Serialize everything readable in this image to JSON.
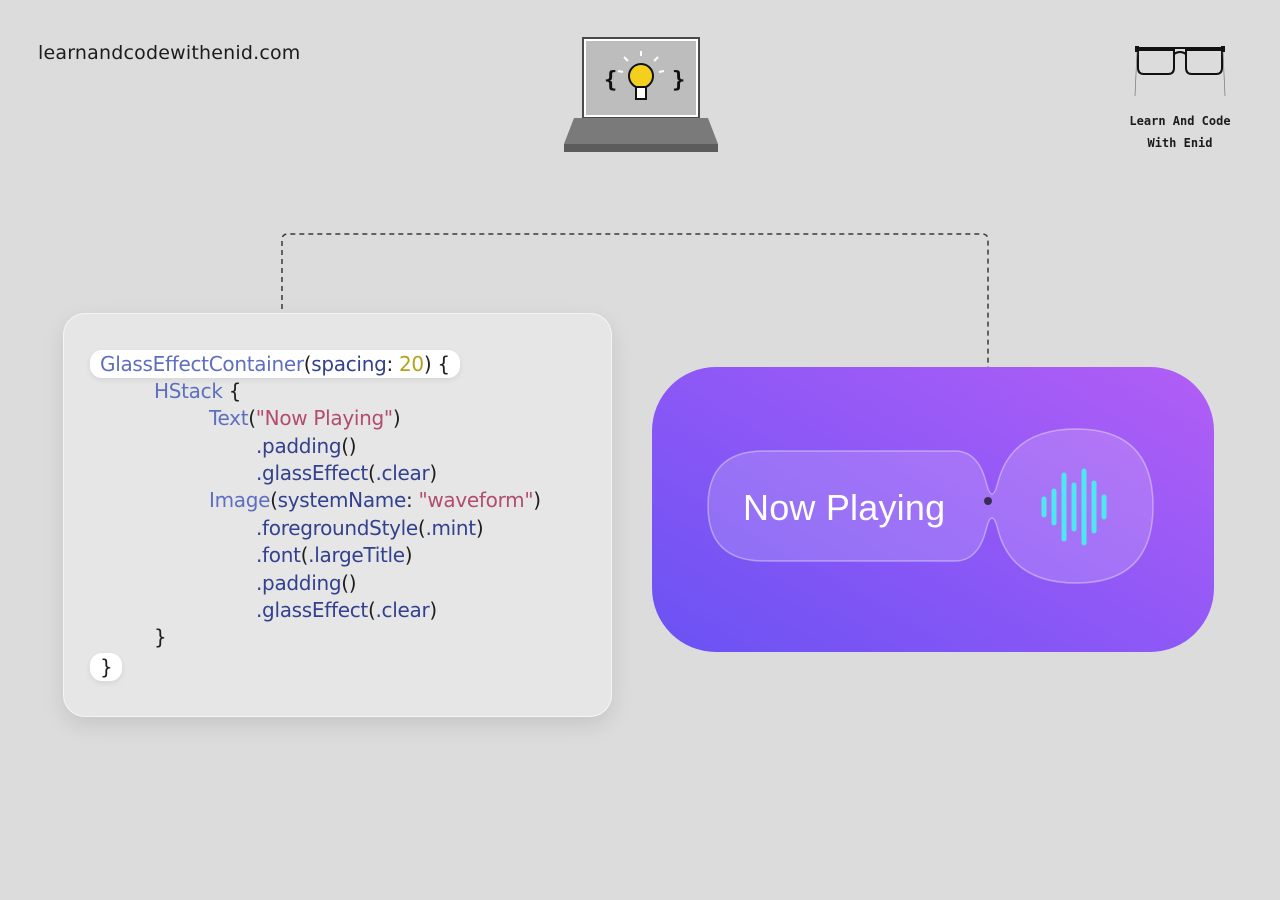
{
  "header": {
    "site_url": "learnandcodewithenid.com",
    "brand_line1": "Learn And Code",
    "brand_line2": "With Enid"
  },
  "code": {
    "line1": {
      "type": "GlassEffectContainer",
      "open": "(",
      "param": "spacing",
      "colon": ": ",
      "value": "20",
      "close": ") {"
    },
    "line2": {
      "type": "HStack",
      "rest": " {"
    },
    "line3": {
      "type": "Text",
      "open": "(",
      "string": "\"Now Playing\"",
      "close": ")"
    },
    "line4": {
      "method": ".padding",
      "rest": "()"
    },
    "line5": {
      "method": ".glassEffect",
      "open": "(",
      "arg": ".clear",
      "close": ")"
    },
    "line6": {
      "type": "Image",
      "open": "(",
      "param": "systemName",
      "colon": ": ",
      "string": "\"waveform\"",
      "close": ")"
    },
    "line7": {
      "method": ".foregroundStyle",
      "open": "(",
      "arg": ".mint",
      "close": ")"
    },
    "line8": {
      "method": ".font",
      "open": "(",
      "arg": ".largeTitle",
      "close": ")"
    },
    "line9": {
      "method": ".padding",
      "rest": "()"
    },
    "line10": {
      "method": ".glassEffect",
      "open": "(",
      "arg": ".clear",
      "close": ")"
    },
    "line11": {
      "text": "}"
    },
    "line12": {
      "text": "}"
    }
  },
  "preview": {
    "label": "Now Playing",
    "icon": "waveform-icon",
    "waveform_color": "#4fe6f0"
  },
  "colors": {
    "background": "#dcdcdc",
    "gradient_start": "#6a52f3",
    "gradient_end": "#b25ef5",
    "bulb": "#f5cf1e"
  },
  "icons": [
    "laptop-lightbulb-icon",
    "glasses-icon",
    "waveform-icon"
  ]
}
